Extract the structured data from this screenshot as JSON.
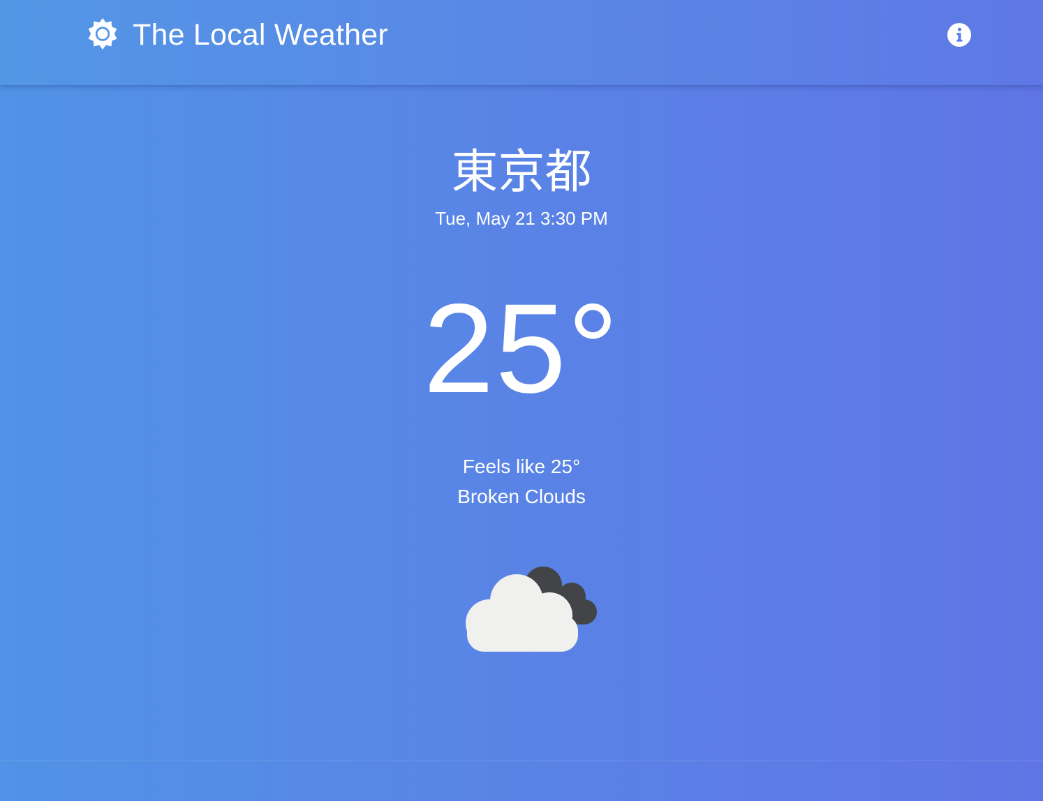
{
  "app_bar": {
    "title": "The Local Weather",
    "logo_icon": "sun-icon",
    "info_icon": "info-icon",
    "background_start": "#5396e6",
    "background_end": "#5f78e5"
  },
  "weather": {
    "city": "東京都",
    "datetime": "Tue, May 21 3:30 PM",
    "temperature": "25°",
    "feels_like": "Feels like 25°",
    "description": "Broken Clouds",
    "condition_icon": "broken-clouds-icon"
  },
  "colors": {
    "text": "#ffffff",
    "cloud_light": "#f0f0ee",
    "cloud_dark": "#434448"
  }
}
